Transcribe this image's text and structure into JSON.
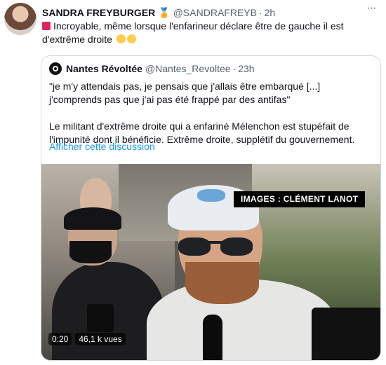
{
  "tweet": {
    "author_name": "SANDRA FREYBURGER",
    "medal_icon": "medal-icon",
    "handle": "@SANDRAFREYB",
    "separator": "·",
    "time": "2h",
    "text": "Incroyable, même lorsque l'enfarineur déclare être de gauche il est d'extrême droite",
    "lead_emoji": "police-light-emoji",
    "trailing_emojis": [
      "rofl-emoji",
      "rofl-emoji"
    ]
  },
  "quote": {
    "author_name": "Nantes Révoltée",
    "handle": "@Nantes_Revoltee",
    "separator": "·",
    "time": "23h",
    "paragraph1": "\"je m'y attendais pas, je pensais que j'allais être embarqué [...] j'comprends pas que j'ai pas été frappé par des antifas\"",
    "paragraph2": "Le militant d'extrême droite qui a enfariné Mélenchon est stupéfait de l'impunité dont il bénéficie. Extrême droite, supplétif du gouvernement.",
    "show_thread": "Afficher cette discussion"
  },
  "video": {
    "credit": "IMAGES : CLÉMENT LANOT",
    "duration": "0:20",
    "views": "46,1 k vues"
  },
  "colors": {
    "link": "#1d9bf0",
    "muted": "#536471",
    "text": "#0f1419",
    "border": "#cfd9de"
  }
}
